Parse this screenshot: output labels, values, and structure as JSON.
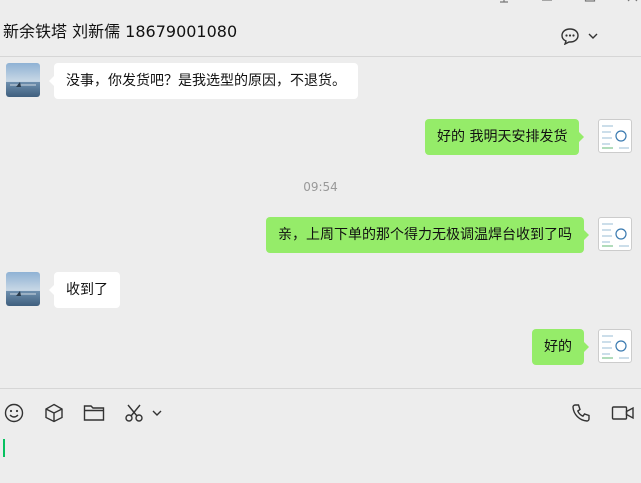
{
  "header": {
    "title": "新余铁塔 刘新儒 18679001080"
  },
  "messages": [
    {
      "side": "left",
      "text": "没事，你发货吧？是我选型的原因，不退货。"
    },
    {
      "side": "right",
      "text": "好的 我明天安排发货"
    },
    {
      "side": "right",
      "text": "亲，上周下单的那个得力无极调温焊台收到了吗"
    },
    {
      "side": "left",
      "text": "收到了"
    },
    {
      "side": "right",
      "text": "好的"
    }
  ],
  "timestamp": "09:54",
  "icons": {
    "pin": "pin-icon",
    "minimize": "minimize-icon",
    "maximize": "maximize-icon",
    "close": "close-icon",
    "chat_more": "chat-bubble-icon",
    "emoji": "emoji-icon",
    "sticker": "cube-icon",
    "file": "folder-icon",
    "screenshot": "scissors-icon",
    "voice_call": "phone-icon",
    "video_call": "video-icon"
  },
  "colors": {
    "self_bubble": "#95ec69",
    "other_bubble": "#ffffff",
    "background": "#ededed",
    "caret": "#07c160"
  }
}
